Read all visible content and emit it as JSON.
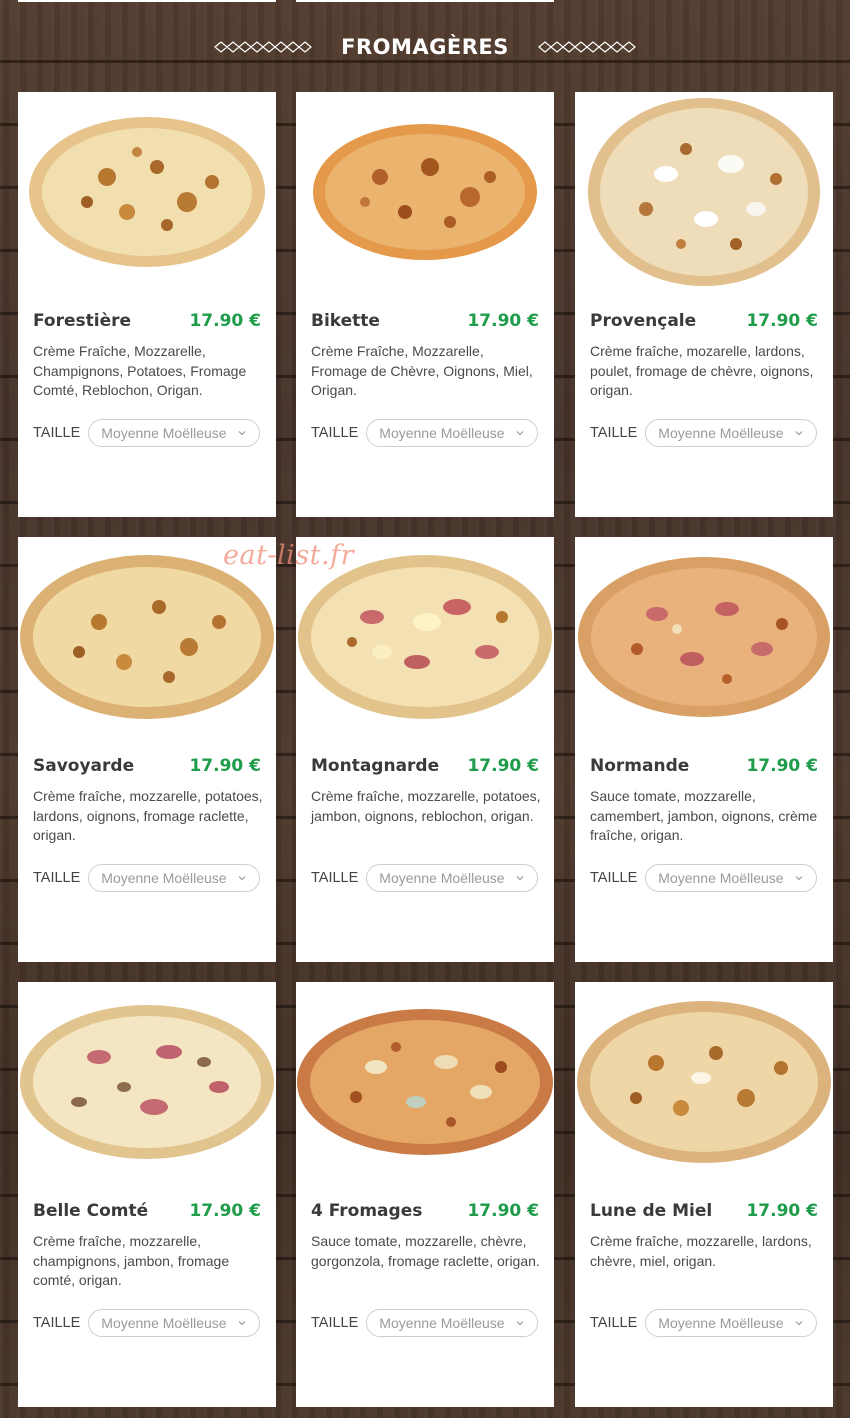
{
  "section": {
    "title": "FROMAGÈRES"
  },
  "watermark": "eat-list.fr",
  "size_label": "TAILLE",
  "size_default": "Moyenne Moëlleuse",
  "accent_color": "#1e9c4a",
  "pizzas": [
    {
      "name": "Forestière",
      "price": "17.90 €",
      "description": "Crème Fraîche, Mozzarelle, Champignons, Potatoes, Fromage Comté, Reblochon, Origan."
    },
    {
      "name": "Bikette",
      "price": "17.90 €",
      "description": "Crème Fraîche, Mozzarelle, Fromage de Chèvre, Oignons, Miel, Origan."
    },
    {
      "name": "Provençale",
      "price": "17.90 €",
      "description": "Crème fraîche, mozarelle, lardons, poulet, fromage de chèvre, oignons, origan."
    },
    {
      "name": "Savoyarde",
      "price": "17.90 €",
      "description": "Crème fraîche, mozzarelle, potatoes, lardons, oignons, fromage raclette, origan."
    },
    {
      "name": "Montagnarde",
      "price": "17.90 €",
      "description": "Crème fraîche, mozzarelle, potatoes, jambon, oignons, reblochon, origan."
    },
    {
      "name": "Normande",
      "price": "17.90 €",
      "description": "Sauce tomate, mozzarelle, camembert, jambon, oignons, crème fraîche, origan."
    },
    {
      "name": "Belle Comté",
      "price": "17.90 €",
      "description": "Crème fraîche, mozzarelle, champignons, jambon, fromage comté, origan."
    },
    {
      "name": "4 Fromages",
      "price": "17.90 €",
      "description": "Sauce tomate, mozzarelle, chèvre, gorgonzola, fromage raclette, origan."
    },
    {
      "name": "Lune de Miel",
      "price": "17.90 €",
      "description": "Crème fraîche, mozzarelle, lardons, chèvre, miel, origan."
    }
  ]
}
